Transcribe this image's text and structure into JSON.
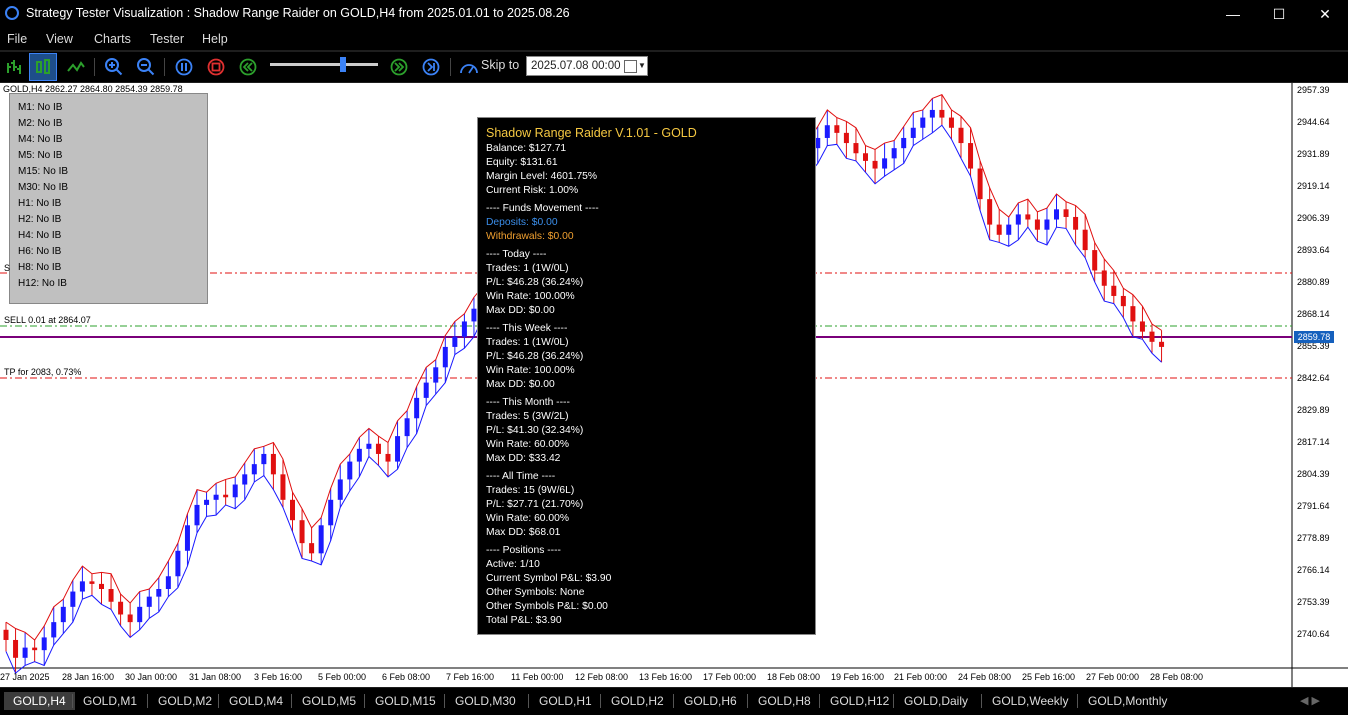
{
  "window": {
    "title": "Strategy Tester Visualization : Shadow Range Raider on GOLD,H4 from 2025.01.01 to 2025.08.26",
    "minimize": "—",
    "maximize": "☐",
    "close": "✕"
  },
  "menu": [
    "File",
    "View",
    "Charts",
    "Tester",
    "Help"
  ],
  "toolbar": {
    "skip_label": "Skip to",
    "skip_value": "2025.07.08 00:00",
    "speed_level": 0.65
  },
  "chart": {
    "symbol_info": "GOLD,H4  2862.27 2864.80 2854.39 2859.78",
    "current_price": "2859.78",
    "price_labels": [
      "2957.39",
      "2944.64",
      "2931.89",
      "2919.14",
      "2906.39",
      "2893.64",
      "2880.89",
      "2868.14",
      "2855.39",
      "2842.64",
      "2829.89",
      "2817.14",
      "2804.39",
      "2791.64",
      "2778.89",
      "2766.14",
      "2753.39",
      "2740.64"
    ],
    "time_labels": [
      "27 Jan 2025",
      "28 Jan 16:00",
      "30 Jan 00:00",
      "31 Jan 08:00",
      "3 Feb 16:00",
      "5 Feb 00:00",
      "6 Feb 08:00",
      "7 Feb 16:00",
      "11 Feb 00:00",
      "12 Feb 08:00",
      "13 Feb 16:00",
      "17 Feb 00:00",
      "18 Feb 08:00",
      "19 Feb 16:00",
      "21 Feb 00:00",
      "24 Feb 08:00",
      "25 Feb 16:00",
      "27 Feb 00:00",
      "28 Feb 08:00"
    ],
    "line_labels": {
      "sell": "SELL 0.01 at 2864.07",
      "tp": "TP for 2083, 0.73%",
      "s_mark": "S"
    },
    "colors": {
      "bull": "#1a1aff",
      "bear": "#e01010",
      "sell_line": "#2ca02c",
      "tp_line": "#e01010",
      "price_line": "#7a007a"
    }
  },
  "ib_panel": [
    "M1: No IB",
    "M2: No IB",
    "M4: No IB",
    "M5: No IB",
    "M15: No IB",
    "M30: No IB",
    "H1: No IB",
    "H2: No IB",
    "H4: No IB",
    "H6: No IB",
    "H8: No IB",
    "H12: No IB"
  ],
  "info_panel": {
    "title": "Shadow Range Raider V.1.01 - GOLD",
    "lines": [
      {
        "t": "Balance: $127.71",
        "c": "#fff"
      },
      {
        "t": "Equity: $131.61",
        "c": "#fff"
      },
      {
        "t": "Margin Level: 4601.75%",
        "c": "#fff"
      },
      {
        "t": "Current Risk: 1.00%",
        "c": "#fff"
      },
      {
        "t": "---- Funds Movement ----",
        "c": "#fff"
      },
      {
        "t": "Deposits: $0.00",
        "c": "#3b8eea"
      },
      {
        "t": "Withdrawals: $0.00",
        "c": "#f0a030"
      },
      {
        "t": "---- Today ----",
        "c": "#fff"
      },
      {
        "t": "Trades: 1 (1W/0L)",
        "c": "#fff"
      },
      {
        "t": "P/L: $46.28 (36.24%)",
        "c": "#fff"
      },
      {
        "t": "Win Rate: 100.00%",
        "c": "#fff"
      },
      {
        "t": "Max DD: $0.00",
        "c": "#fff"
      },
      {
        "t": "---- This Week ----",
        "c": "#fff"
      },
      {
        "t": "Trades: 1 (1W/0L)",
        "c": "#fff"
      },
      {
        "t": "P/L: $46.28 (36.24%)",
        "c": "#fff"
      },
      {
        "t": "Win Rate: 100.00%",
        "c": "#fff"
      },
      {
        "t": "Max DD: $0.00",
        "c": "#fff"
      },
      {
        "t": "---- This Month ----",
        "c": "#fff"
      },
      {
        "t": "Trades: 5 (3W/2L)",
        "c": "#fff"
      },
      {
        "t": "P/L: $41.30 (32.34%)",
        "c": "#fff"
      },
      {
        "t": "Win Rate: 60.00%",
        "c": "#fff"
      },
      {
        "t": "Max DD: $33.42",
        "c": "#fff"
      },
      {
        "t": "---- All Time ----",
        "c": "#fff"
      },
      {
        "t": "Trades: 15 (9W/6L)",
        "c": "#fff"
      },
      {
        "t": "P/L: $27.71 (21.70%)",
        "c": "#fff"
      },
      {
        "t": "Win Rate: 60.00%",
        "c": "#fff"
      },
      {
        "t": "Max DD: $68.01",
        "c": "#fff"
      },
      {
        "t": "---- Positions ----",
        "c": "#fff"
      },
      {
        "t": "Active: 1/10",
        "c": "#fff"
      },
      {
        "t": "Current Symbol P&L: $3.90",
        "c": "#fff"
      },
      {
        "t": "Other Symbols: None",
        "c": "#fff"
      },
      {
        "t": "Other Symbols P&L: $0.00",
        "c": "#fff"
      },
      {
        "t": "Total P&L: $3.90",
        "c": "#fff"
      }
    ]
  },
  "tabs": [
    "GOLD,H4",
    "GOLD,M1",
    "GOLD,M2",
    "GOLD,M4",
    "GOLD,M5",
    "GOLD,M15",
    "GOLD,M30",
    "GOLD,H1",
    "GOLD,H2",
    "GOLD,H6",
    "GOLD,H8",
    "GOLD,H12",
    "GOLD,Daily",
    "GOLD,Weekly",
    "GOLD,Monthly"
  ],
  "active_tab": 0,
  "chart_data": {
    "type": "candlestick",
    "y_range": [
      2734,
      2962
    ],
    "closes": [
      2745,
      2738,
      2742,
      2741,
      2746,
      2752,
      2758,
      2764,
      2768,
      2767,
      2765,
      2760,
      2755,
      2752,
      2758,
      2762,
      2765,
      2770,
      2780,
      2790,
      2798,
      2800,
      2802,
      2801,
      2806,
      2810,
      2814,
      2818,
      2810,
      2800,
      2792,
      2783,
      2779,
      2790,
      2800,
      2808,
      2815,
      2820,
      2822,
      2818,
      2815,
      2825,
      2832,
      2840,
      2846,
      2852,
      2860,
      2864,
      2870,
      2875,
      2878,
      2871,
      2864,
      2858,
      2860,
      2866,
      2870,
      2872,
      2868,
      2862,
      2859,
      2866,
      2870,
      2878,
      2882,
      2885,
      2888,
      2891,
      2893,
      2895,
      2898,
      2902,
      2906,
      2910,
      2915,
      2920,
      2924,
      2928,
      2932,
      2936,
      2934,
      2930,
      2927,
      2932,
      2938,
      2942,
      2947,
      2944,
      2940,
      2936,
      2933,
      2930,
      2934,
      2938,
      2942,
      2946,
      2950,
      2953,
      2950,
      2946,
      2940,
      2930,
      2918,
      2908,
      2904,
      2908,
      2912,
      2910,
      2906,
      2910,
      2914,
      2911,
      2906,
      2898,
      2890,
      2884,
      2880,
      2876,
      2870,
      2866,
      2862,
      2860
    ]
  }
}
